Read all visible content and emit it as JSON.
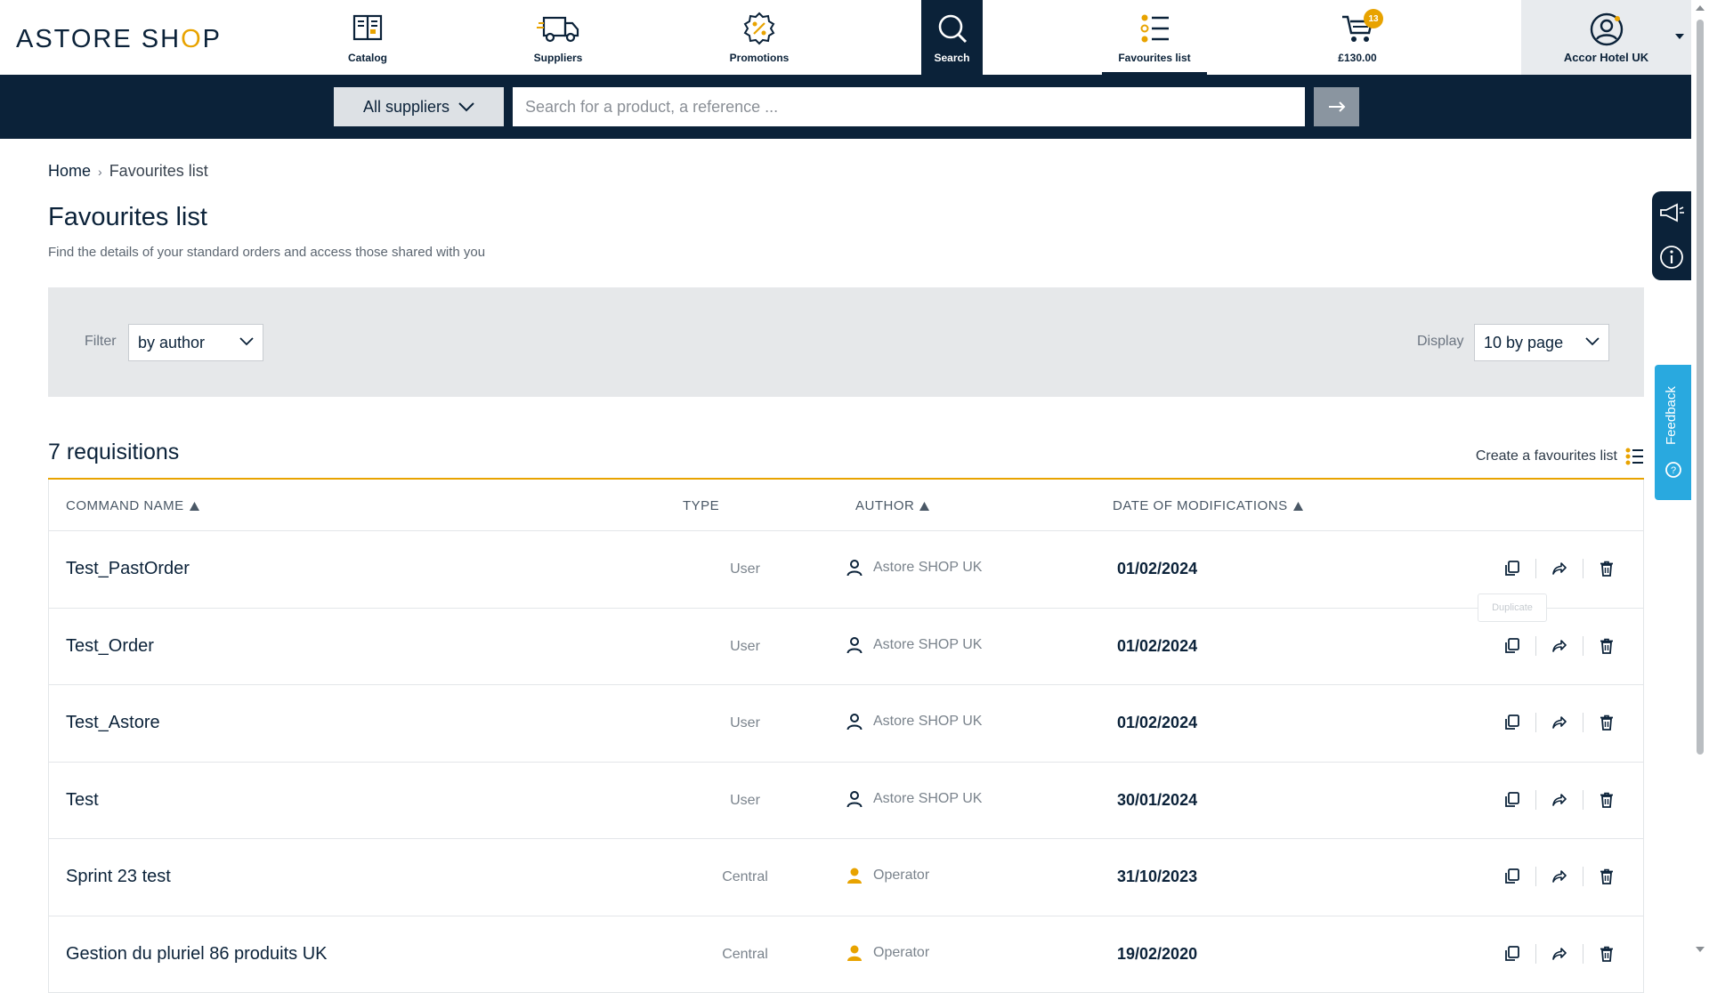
{
  "brand": {
    "logo_text_1": "ASTORE SH",
    "logo_bag": "O",
    "logo_text_2": "P",
    "accent": "#e8a300",
    "navy": "#0b2239"
  },
  "nav": {
    "catalog": "Catalog",
    "suppliers": "Suppliers",
    "promotions": "Promotions",
    "search": "Search",
    "favourites": "Favourites list",
    "cart_amount": "£130.00",
    "cart_count": "13",
    "account": "Accor Hotel UK"
  },
  "search": {
    "supplier_filter": "All suppliers",
    "placeholder": "Search for a product, a reference ..."
  },
  "breadcrumb": {
    "home": "Home",
    "current": "Favourites list"
  },
  "page": {
    "title": "Favourites list",
    "subtitle": "Find the details of your standard orders and access those shared with you"
  },
  "filters": {
    "filter_label": "Filter",
    "filter_value": "by author",
    "display_label": "Display",
    "display_value": "10 by page"
  },
  "list": {
    "count": "7 requisitions",
    "create_label": "Create a favourites list",
    "columns": {
      "name": "COMMAND NAME",
      "type": "TYPE",
      "author": "AUTHOR",
      "date": "DATE OF MODIFICATIONS"
    },
    "tooltip": "Duplicate",
    "rows": [
      {
        "name": "Test_PastOrder",
        "type": "User",
        "author": "Astore SHOP UK",
        "author_kind": "user",
        "date": "01/02/2024"
      },
      {
        "name": "Test_Order",
        "type": "User",
        "author": "Astore SHOP UK",
        "author_kind": "user",
        "date": "01/02/2024"
      },
      {
        "name": "Test_Astore",
        "type": "User",
        "author": "Astore SHOP UK",
        "author_kind": "user",
        "date": "01/02/2024"
      },
      {
        "name": "Test",
        "type": "User",
        "author": "Astore SHOP UK",
        "author_kind": "user",
        "date": "30/01/2024"
      },
      {
        "name": "Sprint 23 test",
        "type": "Central",
        "author": "Operator",
        "author_kind": "operator",
        "date": "31/10/2023"
      },
      {
        "name": "Gestion du pluriel 86 produits UK",
        "type": "Central",
        "author": "Operator",
        "author_kind": "operator",
        "date": "19/02/2020"
      }
    ]
  },
  "side": {
    "feedback": "Feedback"
  }
}
